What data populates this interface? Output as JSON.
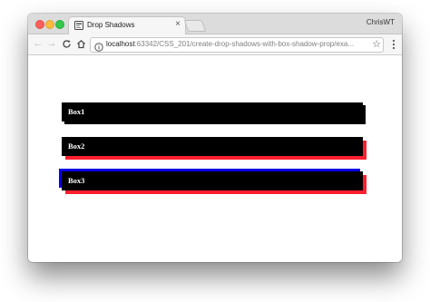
{
  "tab": {
    "title": "Drop Shadows",
    "close_glyph": "×",
    "favicon": "page-icon"
  },
  "profile": {
    "name": "ChrisWT"
  },
  "toolbar": {
    "back_glyph": "←",
    "forward_glyph": "→",
    "reload_glyph": "C",
    "home_glyph": "⌂",
    "star_glyph": "☆"
  },
  "address": {
    "host": "localhost",
    "rest": ":63342/CSS_201/create-drop-shadows-with-box-shadow-prop/exa..."
  },
  "boxes": [
    {
      "label": "Box1",
      "background": "#000000",
      "shadows": [
        {
          "color": "#000000"
        }
      ]
    },
    {
      "label": "Box2",
      "background": "#000000",
      "shadows": [
        {
          "color": "#ff1f2e"
        }
      ]
    },
    {
      "label": "Box3",
      "background": "#000000",
      "shadows": [
        {
          "color": "#ff1f2e"
        },
        {
          "color": "#0a00e6"
        }
      ]
    }
  ],
  "colors": {
    "traffic_close": "#fc605b",
    "traffic_minimize": "#fdbc40",
    "traffic_zoom": "#34c84a",
    "shadow_red": "#ff1f2e",
    "shadow_blue": "#0a00e6"
  }
}
